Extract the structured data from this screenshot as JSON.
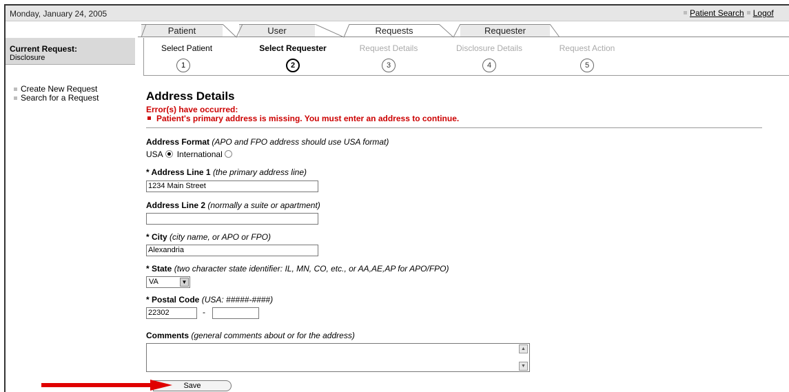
{
  "header": {
    "date": "Monday, January 24, 2005",
    "links": [
      "Patient Search",
      "Logof"
    ]
  },
  "tabs": [
    "Patient",
    "User",
    "Requests",
    "Requester"
  ],
  "active_tab": "Requests",
  "sidebar": {
    "current_label": "Current Request:",
    "current_value": "Disclosure",
    "nav": [
      "Create New Request",
      "Search for a Request"
    ]
  },
  "steps": [
    {
      "label": "Select Patient",
      "num": "1"
    },
    {
      "label": "Select Requester",
      "num": "2"
    },
    {
      "label": "Request Details",
      "num": "3"
    },
    {
      "label": "Disclosure Details",
      "num": "4"
    },
    {
      "label": "Request Action",
      "num": "5"
    }
  ],
  "form": {
    "title": "Address Details",
    "error_heading": "Error(s) have occurred:",
    "error_message": "Patient's primary address is missing. You must enter an address to continue.",
    "format_label": "Address Format",
    "format_hint": "(APO and FPO address should use USA format)",
    "format_usa": "USA",
    "format_intl": "International",
    "line1_label": "* Address Line 1",
    "line1_hint": "(the primary address line)",
    "line1_value": "1234 Main Street",
    "line2_label": "Address Line 2",
    "line2_hint": "(normally a suite or apartment)",
    "line2_value": "",
    "city_label": "* City",
    "city_hint": "(city name, or APO or FPO)",
    "city_value": "Alexandria",
    "state_label": "* State",
    "state_hint": "(two character state identifier: IL, MN, CO, etc., or AA,AE,AP for APO/FPO)",
    "state_value": "VA",
    "postal_label": "* Postal Code",
    "postal_hint": "(USA: #####-####)",
    "postal_value": "22302",
    "postal_ext_value": "",
    "postal_sep": "-",
    "comments_label": "Comments",
    "comments_hint": "(general comments about or for the address)",
    "save_label": "Save"
  },
  "colors": {
    "error": "#cc0000",
    "arrow": "#e00000"
  }
}
